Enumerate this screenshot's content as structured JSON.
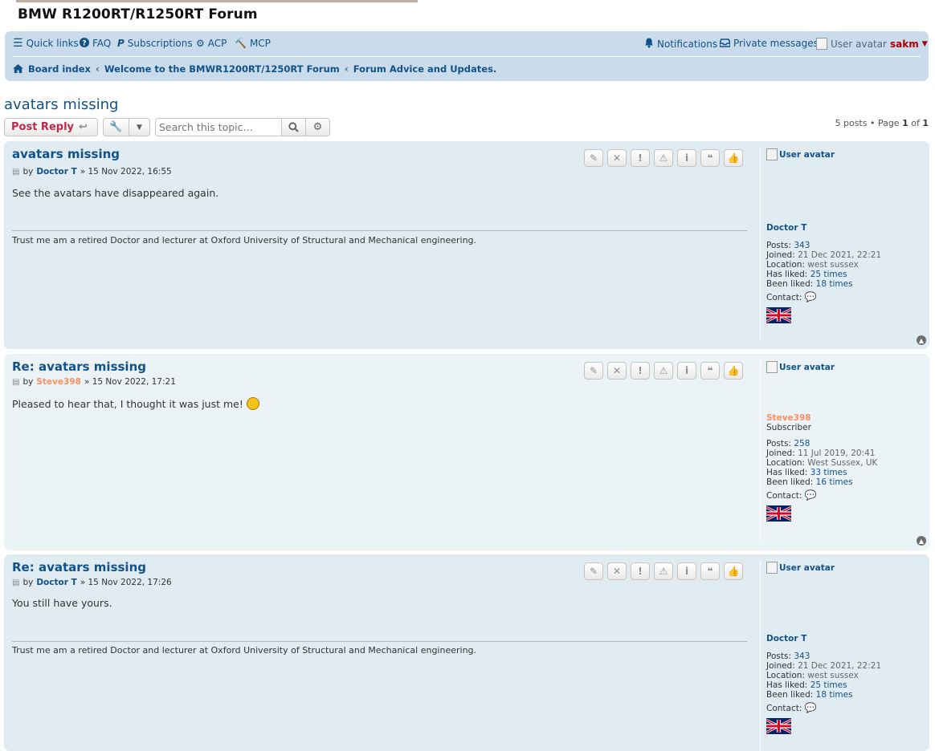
{
  "site": {
    "title": "BMW R1200RT/R1250RT Forum"
  },
  "nav": {
    "quick_links": "Quick links",
    "faq": "FAQ",
    "subscriptions": "Subscriptions",
    "acp": "ACP",
    "mcp": "MCP",
    "notifications": "Notifications",
    "private_messages": "Private messages",
    "avatar_alt": "User avatar",
    "username": "sakm"
  },
  "breadcrumbs": [
    "Board index",
    "Welcome to the BMWR1200RT/1250RT Forum",
    "Forum Advice and Updates."
  ],
  "topic": {
    "title": "avatars missing",
    "post_reply": "Post Reply",
    "search_placeholder": "Search this topic…",
    "pagination_prefix": "5 posts • Page",
    "page_current": "1",
    "page_of": "of",
    "page_total": "1"
  },
  "posts": [
    {
      "subject": "avatars missing",
      "by": "by",
      "author": "Doctor T",
      "date": "» 15 Nov 2022, 16:55",
      "content": "See the avatars have disappeared again.",
      "signature": "Trust me am a retired Doctor and lecturer at Oxford University of Structural and Mechanical engineering.",
      "profile": {
        "avatar_alt": "User avatar",
        "name": "Doctor T",
        "rank": "",
        "posts_label": "Posts:",
        "posts": "343",
        "joined_label": "Joined:",
        "joined": "21 Dec 2021, 22:21",
        "location_label": "Location:",
        "location": "west sussex",
        "has_liked_label": "Has liked:",
        "has_liked": "25 times",
        "been_liked_label": "Been liked:",
        "been_liked": "18 times",
        "contact_label": "Contact:"
      }
    },
    {
      "subject": "Re: avatars missing",
      "by": "by",
      "author": "Steve398",
      "date": "» 15 Nov 2022, 17:21",
      "content": "Pleased to hear that, I thought it was just me!",
      "signature": "",
      "profile": {
        "avatar_alt": "User avatar",
        "name": "Steve398",
        "rank": "Subscriber",
        "posts_label": "Posts:",
        "posts": "258",
        "joined_label": "Joined:",
        "joined": "11 Jul 2019, 20:41",
        "location_label": "Location:",
        "location": "West Sussex, UK",
        "has_liked_label": "Has liked:",
        "has_liked": "33 times",
        "been_liked_label": "Been liked:",
        "been_liked": "16 times",
        "contact_label": "Contact:"
      }
    },
    {
      "subject": "Re: avatars missing",
      "by": "by",
      "author": "Doctor T",
      "date": "» 15 Nov 2022, 17:26",
      "content": "You still have yours.",
      "signature": "Trust me am a retired Doctor and lecturer at Oxford University of Structural and Mechanical engineering.",
      "profile": {
        "avatar_alt": "User avatar",
        "name": "Doctor T",
        "rank": "",
        "posts_label": "Posts:",
        "posts": "343",
        "joined_label": "Joined:",
        "joined": "21 Dec 2021, 22:21",
        "location_label": "Location:",
        "location": "west sussex",
        "has_liked_label": "Has liked:",
        "has_liked": "25 times",
        "been_liked_label": "Been liked:",
        "been_liked": "18 times",
        "contact_label": "Contact:"
      }
    }
  ],
  "post_button_icons": [
    "pencil-icon",
    "close-icon",
    "exclamation-icon",
    "warning-icon",
    "info-icon",
    "quote-icon",
    "thumbs-up-icon"
  ],
  "colors": {
    "link": "#105289",
    "reply_red": "#bc2a4d",
    "subscriber_orange": "#fe8f5e",
    "post_bg": "#e1ebf2",
    "post_alt_bg": "#ecf3f7",
    "navbar_bg": "#cadceb"
  }
}
